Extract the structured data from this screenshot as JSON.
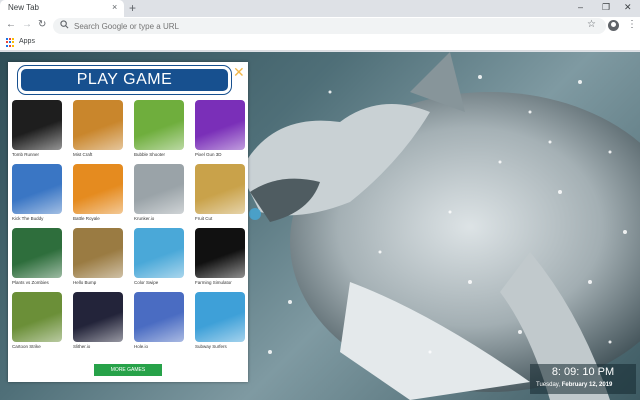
{
  "browser": {
    "tab_title": "New Tab",
    "tab_close": "×",
    "new_tab": "+",
    "omnibox_placeholder": "Search Google or type a URL",
    "bookmarks_apps": "Apps",
    "window_controls": [
      "–",
      "❐",
      "✕"
    ]
  },
  "panel": {
    "title": "PLAY GAME",
    "close": "✕",
    "more_button": "MORE GAMES",
    "games": [
      {
        "name": "Tomb Runner",
        "theme": "#1e1e1e"
      },
      {
        "name": "Mist Craft",
        "theme": "#c9862c"
      },
      {
        "name": "Bubble Shooter",
        "theme": "#6fae3d"
      },
      {
        "name": "Pixel Gun 3D",
        "theme": "#7a2fb8"
      },
      {
        "name": "Kick The Buddy",
        "theme": "#3a76c4"
      },
      {
        "name": "Battle Royale",
        "theme": "#e58b1f"
      },
      {
        "name": "Krunker.io",
        "theme": "#9aa3a8"
      },
      {
        "name": "Fruit Cut",
        "theme": "#c9a24a"
      },
      {
        "name": "Plants vs Zombies",
        "theme": "#2e6e3c"
      },
      {
        "name": "Hello Bump",
        "theme": "#9a7b42"
      },
      {
        "name": "Color Swipe",
        "theme": "#4aa8d8"
      },
      {
        "name": "Farming Simulator",
        "theme": "#111111"
      },
      {
        "name": "Cartoon Strike",
        "theme": "#6b8f38"
      },
      {
        "name": "Slither.io",
        "theme": "#23243a"
      },
      {
        "name": "Hole.io",
        "theme": "#4a6cc2"
      },
      {
        "name": "Subway Surfers",
        "theme": "#3ea0d8"
      }
    ]
  },
  "clock": {
    "time": "8: 09: 10 PM",
    "day": "Tuesday,",
    "date": "February 12, 2019"
  }
}
